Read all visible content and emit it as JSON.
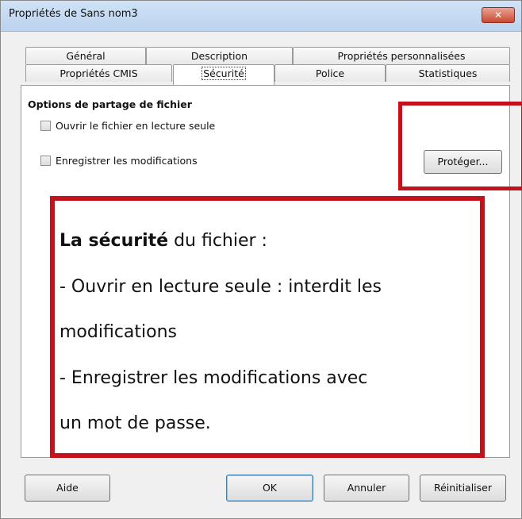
{
  "window": {
    "title": "Propriétés de Sans nom3",
    "close_label": "✕"
  },
  "tabs": {
    "row1": [
      "Général",
      "Description",
      "Propriétés personnalisées"
    ],
    "row2": [
      "Propriétés CMIS",
      "Sécurité",
      "Police",
      "Statistiques"
    ],
    "active": "Sécurité"
  },
  "panel": {
    "section_title": "Options de partage de fichier",
    "option_readonly": "Ouvrir le fichier en lecture seule",
    "option_record": "Enregistrer les modifications",
    "protect_button": "Protéger..."
  },
  "callout": {
    "bold": "La sécurité",
    "line1_rest": " du fichier :",
    "line2": "- Ouvrir en lecture seule : interdit les",
    "line3": "modifications",
    "line4": "- Enregistrer les modifications avec",
    "line5": "un mot de passe."
  },
  "buttons": {
    "help": "Aide",
    "ok": "OK",
    "cancel": "Annuler",
    "reset": "Réinitialiser"
  },
  "colors": {
    "highlight": "#c4121c"
  }
}
